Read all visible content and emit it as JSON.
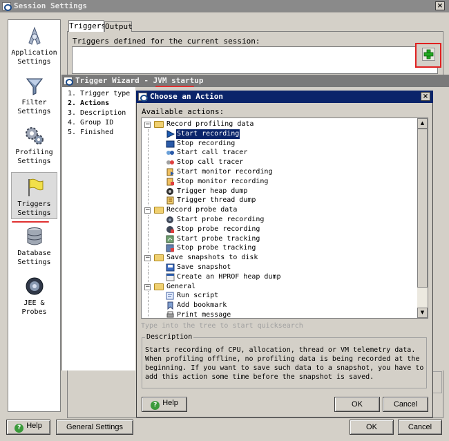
{
  "main_window": {
    "title": "Session Settings",
    "close": "×",
    "tabs": [
      "Triggers",
      "Output"
    ],
    "triggers_caption": "Triggers defined for the current session:",
    "bottom": {
      "help": "Help",
      "general_settings": "General Settings",
      "ok": "OK",
      "cancel": "Cancel"
    },
    "edge_text": "Ca"
  },
  "nav": {
    "items": [
      {
        "label1": "Application",
        "label2": "Settings",
        "icon": "application-icon"
      },
      {
        "label1": "Filter",
        "label2": "Settings",
        "icon": "filter-icon"
      },
      {
        "label1": "Profiling",
        "label2": "Settings",
        "icon": "gears-icon"
      },
      {
        "label1": "Triggers",
        "label2": "Settings",
        "icon": "flag-icon"
      },
      {
        "label1": "Database",
        "label2": "Settings",
        "icon": "database-icon"
      },
      {
        "label1": "JEE &",
        "label2": "Probes",
        "icon": "probe-icon"
      }
    ]
  },
  "wizard": {
    "title_prefix": "Trigger Wizard - ",
    "title_name": "JVM startup",
    "steps": [
      "1. Trigger type",
      "2. Actions",
      "3. Description",
      "4. Group ID",
      "5. Finished"
    ],
    "active_step": 1
  },
  "dialog": {
    "title": "Choose an Action",
    "close": "×",
    "available_label": "Available actions:",
    "tree": [
      {
        "kind": "group",
        "label": "Record profiling data"
      },
      {
        "kind": "action",
        "label": "Start recording",
        "icon": "play-icon",
        "selected": true
      },
      {
        "kind": "action",
        "label": "Stop recording",
        "icon": "stop-icon"
      },
      {
        "kind": "action",
        "label": "Start call tracer",
        "icon": "call-tracer-start-icon"
      },
      {
        "kind": "action",
        "label": "Stop call tracer",
        "icon": "call-tracer-stop-icon"
      },
      {
        "kind": "action",
        "label": "Start monitor recording",
        "icon": "monitor-start-icon"
      },
      {
        "kind": "action",
        "label": "Stop monitor recording",
        "icon": "monitor-stop-icon"
      },
      {
        "kind": "action",
        "label": "Trigger heap dump",
        "icon": "heap-dump-icon"
      },
      {
        "kind": "action",
        "label": "Trigger thread dump",
        "icon": "thread-dump-icon"
      },
      {
        "kind": "group",
        "label": "Record probe data"
      },
      {
        "kind": "action",
        "label": "Start probe recording",
        "icon": "probe-start-icon"
      },
      {
        "kind": "action",
        "label": "Stop probe recording",
        "icon": "probe-stop-icon"
      },
      {
        "kind": "action",
        "label": "Start probe tracking",
        "icon": "tracking-start-icon"
      },
      {
        "kind": "action",
        "label": "Stop probe tracking",
        "icon": "tracking-stop-icon"
      },
      {
        "kind": "group",
        "label": "Save snapshots to disk"
      },
      {
        "kind": "action",
        "label": "Save snapshot",
        "icon": "save-icon"
      },
      {
        "kind": "action",
        "label": "Create an HPROF heap dump",
        "icon": "hprof-icon"
      },
      {
        "kind": "group",
        "label": "General"
      },
      {
        "kind": "action",
        "label": "Run script",
        "icon": "script-icon"
      },
      {
        "kind": "action",
        "label": "Add bookmark",
        "icon": "bookmark-icon"
      },
      {
        "kind": "action",
        "label": "Print message",
        "icon": "print-icon"
      }
    ],
    "quicksearch_hint": "Type into the tree to start quicksearch",
    "description_title": "Description",
    "description_text": "Starts recording of CPU, allocation, thread or VM telemetry data. When profiling offline, no profiling data is being recorded at the beginning. If you want to save such data to a snapshot, you have to add this action some time before the snapshot is saved.",
    "buttons": {
      "help": "Help",
      "ok": "OK",
      "cancel": "Cancel"
    }
  },
  "colors": {
    "dialog_title": "#0a246a",
    "selection": "#0a246a",
    "highlight_box": "#e02020",
    "underline": "#e03030"
  }
}
